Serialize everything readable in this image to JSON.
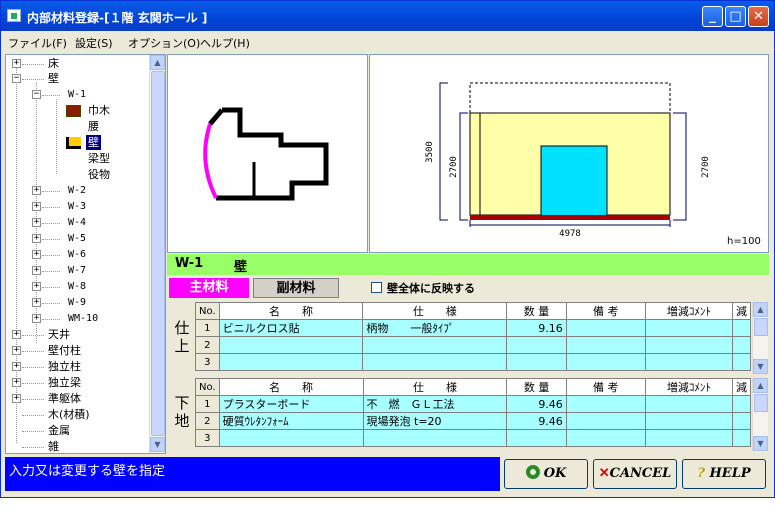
{
  "title": "内部材料登録-[１階 玄関ホール ]",
  "menu": [
    "ファイル(F)",
    "設定(S)",
    "オプション(O)",
    "ヘルプ(H)"
  ],
  "tree": {
    "floor": "床",
    "wall": "壁",
    "w1": "W-1",
    "habaki": "巾木",
    "koshi": "腰",
    "kabe": "壁",
    "harigata": "梁型",
    "yakumono": "役物",
    "w_items": [
      "W-2",
      "W-3",
      "W-4",
      "W-5",
      "W-6",
      "W-7",
      "W-8",
      "W-9",
      "WM-10"
    ],
    "bottom_items": [
      "天井",
      "壁付柱",
      "独立柱",
      "独立梁",
      "準躯体",
      "木(材積)",
      "金属",
      "雑"
    ]
  },
  "drawing": {
    "dim_width": "4978",
    "dim_height_total": "3500",
    "dim_height_left": "2700",
    "dim_height_right": "2700",
    "h_label": "h=100",
    "colors": {
      "wall_fill": "#ffffa8",
      "door": "#00e0ff",
      "floor_line": "#aa0000",
      "plan_highlight": "#ff00ff"
    }
  },
  "section_title": {
    "code": "W-1",
    "name": "壁"
  },
  "tabs": {
    "main": "主材料",
    "sub": "副材料",
    "checkbox_label": "壁全体に反映する"
  },
  "columns": {
    "no": "No.",
    "name": "名　　称",
    "spec": "仕　　様",
    "qty": "数 量",
    "note": "備 考",
    "comment": "増減ｺﾒﾝﾄ",
    "dec": "減"
  },
  "finish": {
    "label": "仕上",
    "rows": [
      {
        "no": "1",
        "name": "ビニルクロス貼",
        "spec": "柄物　　一般ﾀｲﾌﾟ",
        "qty": "9.16",
        "note": "",
        "comment": ""
      },
      {
        "no": "2",
        "name": "",
        "spec": "",
        "qty": "",
        "note": "",
        "comment": ""
      },
      {
        "no": "3",
        "name": "",
        "spec": "",
        "qty": "",
        "note": "",
        "comment": ""
      }
    ]
  },
  "base": {
    "label": "下地",
    "rows": [
      {
        "no": "1",
        "name": "プラスターボード",
        "spec": "不　燃　ＧＬ工法",
        "qty": "9.46",
        "note": "",
        "comment": ""
      },
      {
        "no": "2",
        "name": "硬質ｳﾚﾀﾝﾌｫｰﾑ",
        "spec": "現場発泡 t=20",
        "qty": "9.46",
        "note": "",
        "comment": ""
      },
      {
        "no": "3",
        "name": "",
        "spec": "",
        "qty": "",
        "note": "",
        "comment": ""
      }
    ]
  },
  "status_text": "入力又は変更する壁を指定",
  "buttons": {
    "ok": "OK",
    "cancel": "CANCEL",
    "help": "HELP"
  }
}
